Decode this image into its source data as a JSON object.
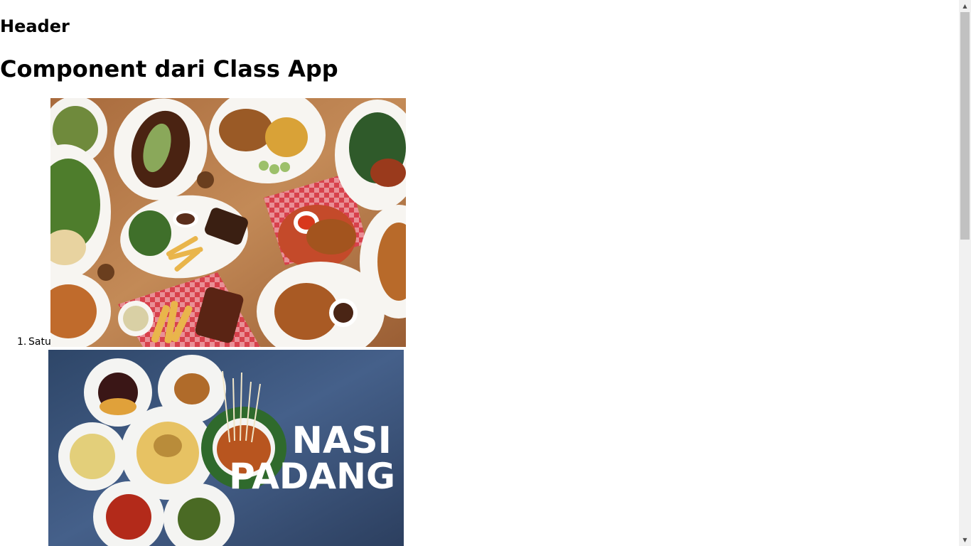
{
  "page": {
    "header": "Header",
    "title": "Component dari Class App"
  },
  "list": {
    "items": [
      {
        "marker": "1.",
        "label": "Satu",
        "image": "food-spread-photo"
      },
      {
        "marker": "",
        "label": "",
        "image": "nasi-padang-photo"
      }
    ]
  },
  "images": {
    "nasi_padang_text_line1": "NASI",
    "nasi_padang_text_line2": "PADANG"
  },
  "scrollbar": {
    "up_icon": "triangle-up",
    "down_icon": "triangle-down"
  }
}
